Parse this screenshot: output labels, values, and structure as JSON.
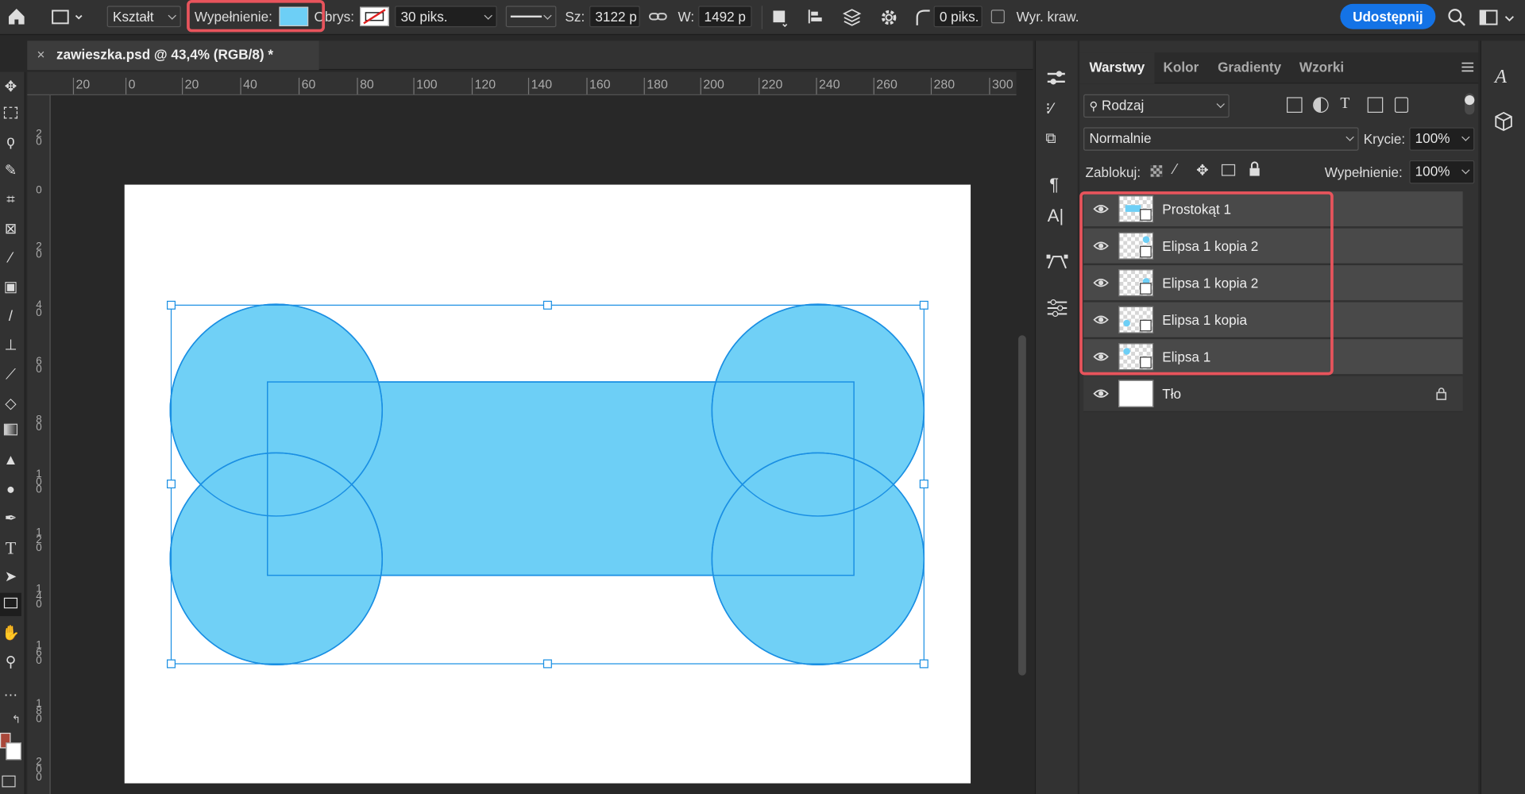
{
  "options_bar": {
    "mode_label": "Kształt",
    "fill_label": "Wypełnienie:",
    "fill_color": "#6dcff6",
    "stroke_label": "Obrys:",
    "stroke_width": "30 piks.",
    "width_label": "Sz:",
    "width_value": "3122 p",
    "height_label": "W:",
    "height_value": "1492 p",
    "corner_value": "0 piks.",
    "align_edges_label": "Wyr. kraw.",
    "share_label": "Udostępnij"
  },
  "document": {
    "tab_title": "zawieszka.psd @ 43,4% (RGB/8) *",
    "shape_fill": "#6dcff6",
    "shape_stroke": "#1a8fe3"
  },
  "ruler": {
    "h_ticks": [
      "20",
      "0",
      "20",
      "40",
      "60",
      "80",
      "100",
      "120",
      "140",
      "160",
      "180",
      "200",
      "220",
      "240",
      "260",
      "280",
      "300"
    ],
    "v_ticks": [
      "2 0",
      "0",
      "2 0",
      "4 0",
      "6 0",
      "8 0",
      "1 0 0",
      "1 2 0",
      "1 4 0",
      "1 6 0",
      "1 8 0",
      "2 0 0"
    ]
  },
  "layers_panel": {
    "tabs": [
      "Warstwy",
      "Kolor",
      "Gradienty",
      "Wzorki"
    ],
    "filter_label": "Rodzaj",
    "blend_mode": "Normalnie",
    "opacity_label": "Krycie:",
    "opacity_value": "100%",
    "lock_label": "Zablokuj:",
    "fill_label": "Wypełnienie:",
    "fill_value": "100%",
    "layers": [
      {
        "name": "Prostokąt 1"
      },
      {
        "name": "Elipsa 1 kopia 2"
      },
      {
        "name": "Elipsa 1 kopia 2"
      },
      {
        "name": "Elipsa 1 kopia"
      },
      {
        "name": "Elipsa 1"
      },
      {
        "name": "Tło"
      }
    ]
  },
  "highlight_color": "#e8545c"
}
